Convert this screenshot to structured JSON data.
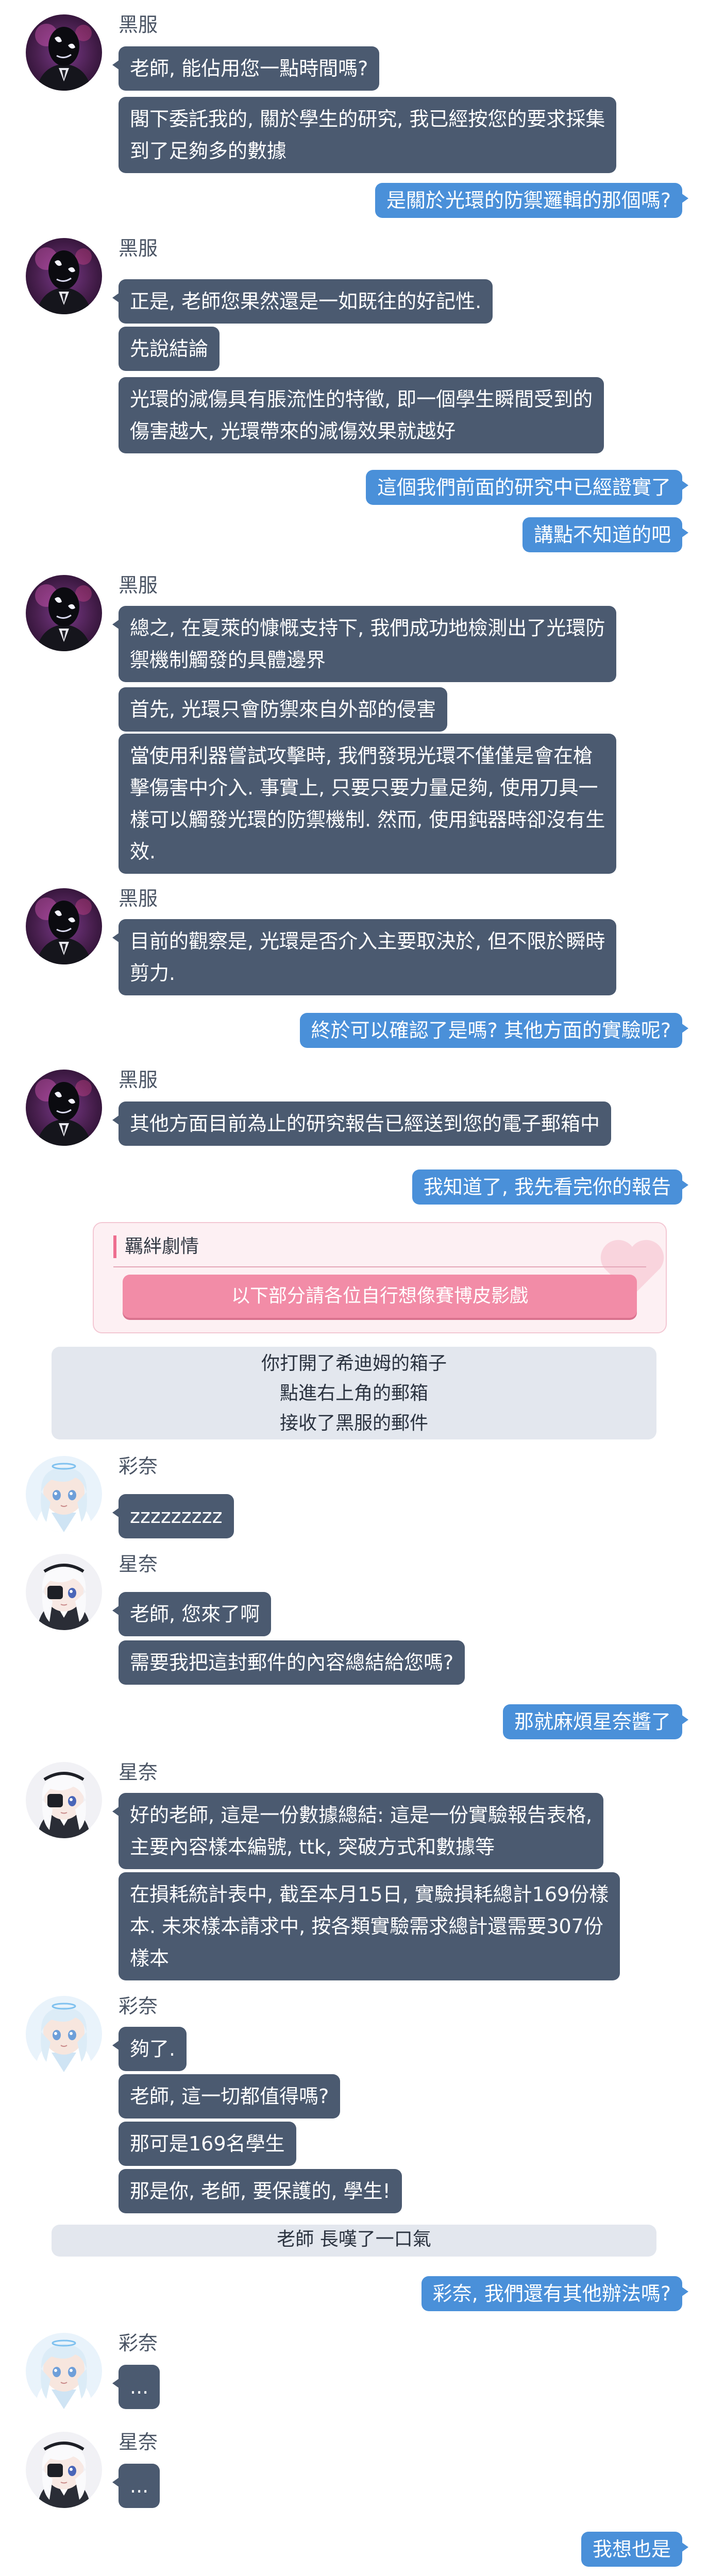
{
  "speakers": {
    "kurofuku": "黑服",
    "ayane": "彩奈",
    "hoshino": "星奈"
  },
  "messages": {
    "m1": "老師, 能佔用您一點時間嗎?",
    "m2a": "閣下委託我的, 關於學生的研究, 我已經按您的要求採集",
    "m2b": "到了足夠多的數據",
    "s1": "是關於光環的防禦邏輯的那個嗎?",
    "m3": "正是, 老師您果然還是一如既往的好記性.",
    "m4": "先說結論",
    "m5a": "光環的減傷具有脹流性的特徵, 即一個學生瞬間受到的",
    "m5b": "傷害越大, 光環帶來的減傷效果就越好",
    "s2": "這個我們前面的研究中已經證實了",
    "s3": "講點不知道的吧",
    "m6a": "總之, 在夏萊的慷慨支持下, 我們成功地檢測出了光環防",
    "m6b": "禦機制觸發的具體邊界",
    "m7": "首先, 光環只會防禦來自外部的侵害",
    "m8a": "當使用利器嘗試攻擊時, 我們發現光環不僅僅是會在槍",
    "m8b": "擊傷害中介入. 事實上, 只要只要力量足夠, 使用刀具一",
    "m8c": "樣可以觸發光環的防禦機制. 然而, 使用鈍器時卻沒有生",
    "m8d": "效.",
    "m9a": "目前的觀察是, 光環是否介入主要取決於, 但不限於瞬時",
    "m9b": "剪力.",
    "s4": "終於可以確認了是嗎? 其他方面的實驗呢?",
    "m10": "其他方面目前為止的研究報告已經送到您的電子郵箱中",
    "s5": "我知道了, 我先看完你的報告",
    "a1": "zzzzzzzzz",
    "h1": "老師, 您來了啊",
    "h2": "需要我把這封郵件的內容總結給您嗎?",
    "s6": "那就麻煩星奈醬了",
    "h3a": "好的老師, 這是一份數據總結: 這是一份實驗報告表格,",
    "h3b": "主要內容樣本編號, ttk, 突破方式和數據等",
    "h4a": "在損耗統計表中, 截至本月15日, 實驗損耗總計169份樣",
    "h4b": "本. 未來樣本請求中, 按各類實驗需求總計還需要307份",
    "h4c": "樣本",
    "a2": "夠了.",
    "a3": "老師, 這一切都值得嗎?",
    "a4": "那可是169名學生",
    "a5": "那是你, 老師, 要保護的, 學生!",
    "s7": "彩奈, 我們還有其他辦法嗎?",
    "a6": "...",
    "h5": "...",
    "s8": "我想也是"
  },
  "bond": {
    "title": "羈絆劇情",
    "button": "以下部分請各位自行想像賽博皮影戲"
  },
  "narration": {
    "n1": "你打開了希迪姆的箱子",
    "n2": "點進右上角的郵箱",
    "n3": "接收了黑服的郵件",
    "n4": "老師 長嘆了一口氣"
  },
  "colors": {
    "npc_bubble": "#4b5a70",
    "sensei_bubble": "#4a90d9",
    "narration_bg": "#e3e7ee",
    "bond_accent": "#f28ca7"
  }
}
